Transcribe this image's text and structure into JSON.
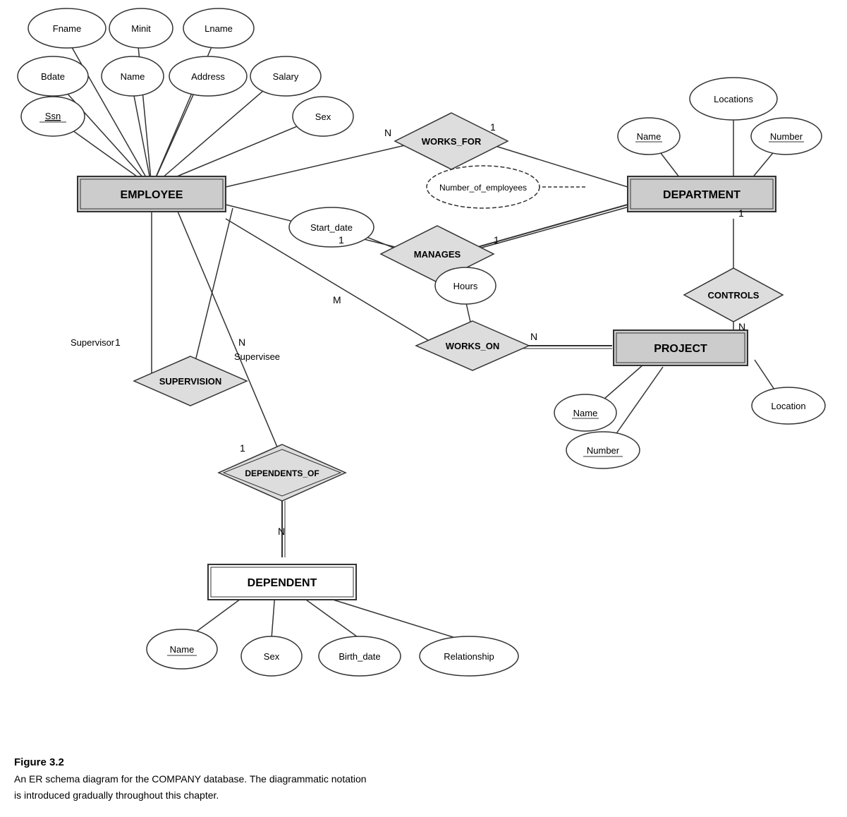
{
  "caption": {
    "title": "Figure 3.2",
    "line1": "An ER schema diagram for the COMPANY database. The diagrammatic notation",
    "line2": "is introduced gradually throughout this chapter."
  },
  "entities": {
    "employee": "EMPLOYEE",
    "department": "DEPARTMENT",
    "project": "PROJECT",
    "dependent": "DEPENDENT"
  },
  "relationships": {
    "works_for": "WORKS_FOR",
    "manages": "MANAGES",
    "works_on": "WORKS_ON",
    "controls": "CONTROLS",
    "supervision": "SUPERVISION",
    "dependents_of": "DEPENDENTS_OF"
  },
  "attributes": {
    "fname": "Fname",
    "minit": "Minit",
    "lname": "Lname",
    "bdate": "Bdate",
    "name_emp": "Name",
    "address": "Address",
    "salary": "Salary",
    "ssn": "Ssn",
    "sex": "Sex",
    "start_date": "Start_date",
    "number_of_employees": "Number_of_employees",
    "locations": "Locations",
    "dept_name": "Name",
    "dept_number": "Number",
    "hours": "Hours",
    "proj_name": "Name",
    "proj_number": "Number",
    "location": "Location",
    "dep_name": "Name",
    "dep_sex": "Sex",
    "birth_date": "Birth_date",
    "relationship": "Relationship"
  },
  "cardinalities": {
    "works_for_emp": "N",
    "works_for_dept": "1",
    "manages_emp": "1",
    "manages_dept": "1",
    "works_on_emp": "M",
    "works_on_proj": "N",
    "controls_dept": "1",
    "controls_proj": "N",
    "supervision_supervisor": "1",
    "supervision_supervisee": "N",
    "dependents_of_emp": "1",
    "dependents_of_dep": "N"
  }
}
